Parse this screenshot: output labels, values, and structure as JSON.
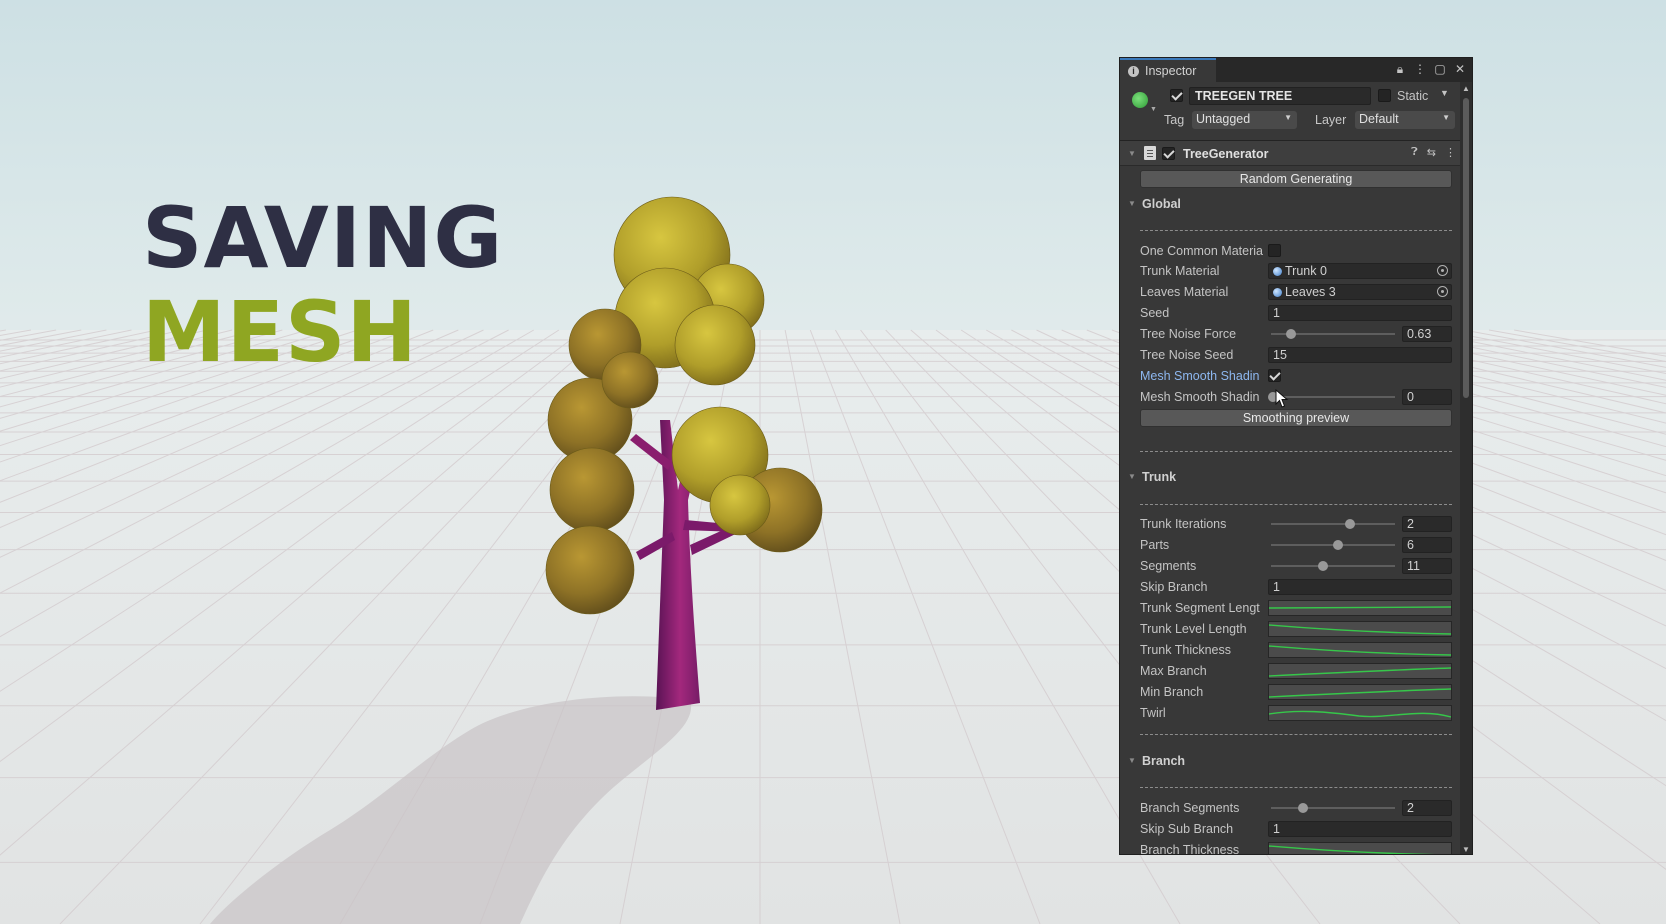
{
  "headline": {
    "line1": "SAVING",
    "line2": "MESH"
  },
  "inspector": {
    "tab_title": "Inspector",
    "object": {
      "name": "TREEGEN TREE",
      "active": true,
      "static_label": "Static",
      "static": false,
      "tag_label": "Tag",
      "tag_value": "Untagged",
      "layer_label": "Layer",
      "layer_value": "Default"
    },
    "component": {
      "name": "TreeGenerator",
      "enabled": true
    },
    "random_button": "Random Generating",
    "global": {
      "title": "Global",
      "one_common_material": "One Common Materia",
      "trunk_material": {
        "label": "Trunk Material",
        "value": "Trunk 0"
      },
      "leaves_material": {
        "label": "Leaves Material",
        "value": "Leaves 3"
      },
      "seed": {
        "label": "Seed",
        "value": "1"
      },
      "tree_noise_force": {
        "label": "Tree Noise Force",
        "value": "0.63",
        "fraction": 0.15
      },
      "tree_noise_seed": {
        "label": "Tree Noise Seed",
        "value": "15"
      },
      "mesh_smooth_toggle": {
        "label": "Mesh Smooth Shadin",
        "checked": true
      },
      "mesh_smooth_value": {
        "label": "Mesh Smooth Shadin",
        "value": "0",
        "fraction": 0.0
      },
      "smoothing_button": "Smoothing preview"
    },
    "trunk": {
      "title": "Trunk",
      "iterations": {
        "label": "Trunk Iterations",
        "value": "2",
        "fraction": 0.65
      },
      "parts": {
        "label": "Parts",
        "value": "6",
        "fraction": 0.55
      },
      "segments": {
        "label": "Segments",
        "value": "11",
        "fraction": 0.42
      },
      "skip_branch": {
        "label": "Skip Branch",
        "value": "1"
      },
      "curves": [
        {
          "label": "Trunk Segment Lengt",
          "shape": "flat"
        },
        {
          "label": "Trunk Level Length",
          "shape": "down"
        },
        {
          "label": "Trunk Thickness",
          "shape": "down"
        },
        {
          "label": "Max Branch",
          "shape": "up"
        },
        {
          "label": "Min Branch",
          "shape": "up"
        },
        {
          "label": "Twirl",
          "shape": "wave"
        }
      ]
    },
    "branch": {
      "title": "Branch",
      "segments": {
        "label": "Branch Segments",
        "value": "2",
        "fraction": 0.25
      },
      "skip_sub_branch": {
        "label": "Skip Sub Branch",
        "value": "1"
      },
      "thickness": {
        "label": "Branch Thickness",
        "shape": "down"
      }
    }
  },
  "colors": {
    "headline_dark": "#2e2f44",
    "headline_green": "#8fa622",
    "trunk": "#8a1e6e",
    "foliage": "#b4a229",
    "curve": "#36c74a"
  }
}
